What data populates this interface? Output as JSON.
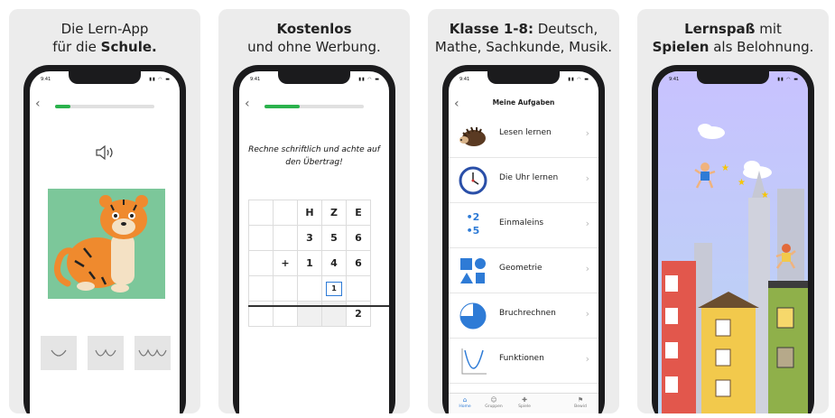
{
  "panels": [
    {
      "caption": {
        "line1": "Die Lern-App",
        "line2_pre": "für die ",
        "line2_bold": "Schule."
      }
    },
    {
      "caption": {
        "line1_bold": "Kostenlos",
        "line2": "und ohne Werbung."
      }
    },
    {
      "caption": {
        "line1_bold": "Klasse 1-8:",
        "line1_rest": " Deutsch,",
        "line2": "Mathe, Sachkunde, Musik."
      }
    },
    {
      "caption": {
        "line1_bold": "Lernspaß",
        "line1_rest": " mit",
        "line2_bold": "Spielen",
        "line2_rest": " als Belohnung."
      }
    }
  ],
  "status": {
    "time": "9:41",
    "icons": "▮▮ ◠ ▬"
  },
  "back_glyph": "‹",
  "lesson1": {
    "progress": 0.15
  },
  "lesson2": {
    "progress": 0.35,
    "instruction": "Rechne schriftlich und achte auf den Übertrag!",
    "grid": {
      "header": [
        "",
        "",
        "H",
        "Z",
        "E"
      ],
      "row1": [
        "",
        "",
        "3",
        "5",
        "6"
      ],
      "row2": [
        "",
        "+",
        "1",
        "4",
        "6"
      ],
      "carry": "1",
      "result": "2"
    }
  },
  "tasks": {
    "title": "Meine Aufgaben",
    "items": [
      {
        "label": "Lesen lernen",
        "icon": "hedgehog-icon"
      },
      {
        "label": "Die Uhr lernen",
        "icon": "clock-icon"
      },
      {
        "label": "Einmaleins",
        "icon": "multiplication-icon",
        "glyph_top": "•2",
        "glyph_bottom": "•5"
      },
      {
        "label": "Geometrie",
        "icon": "shapes-icon"
      },
      {
        "label": "Bruchrechnen",
        "icon": "pie-fraction-icon"
      },
      {
        "label": "Funktionen",
        "icon": "function-graph-icon"
      }
    ],
    "chevron": "›",
    "tabbar": [
      {
        "label": "Home",
        "glyph": "⌂"
      },
      {
        "label": "Gruppen",
        "glyph": "☺"
      },
      {
        "label": "Spiele",
        "glyph": "✚"
      },
      {
        "label": "Bewid",
        "glyph": "⚑"
      }
    ]
  },
  "colors": {
    "accent_blue": "#2e7bd6",
    "progress_green": "#2bb24c",
    "tiger_bg": "#7cc79a",
    "tiger_orange": "#ef8a2e"
  }
}
